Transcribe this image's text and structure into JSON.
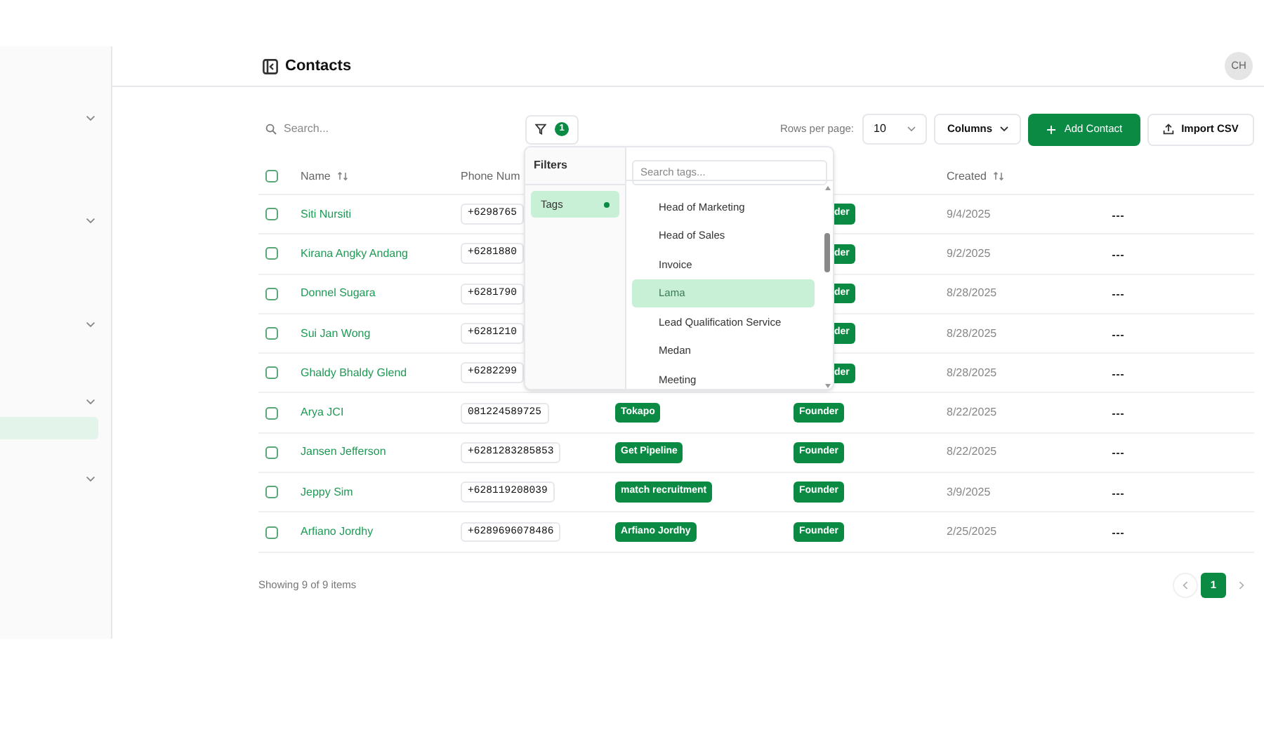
{
  "sidebar": {
    "rows": [
      {
        "kind": "group"
      },
      {
        "kind": "item",
        "selected": false
      },
      {
        "kind": "item",
        "selected": false
      },
      {
        "kind": "item",
        "selected": false
      },
      {
        "kind": "group"
      },
      {
        "kind": "item",
        "selected": false
      },
      {
        "kind": "item",
        "selected": false
      },
      {
        "kind": "item",
        "selected": false
      },
      {
        "kind": "group"
      },
      {
        "kind": "item",
        "selected": false
      },
      {
        "kind": "item",
        "selected": false
      },
      {
        "kind": "group"
      },
      {
        "kind": "item",
        "selected": true
      },
      {
        "kind": "item",
        "selected": false
      },
      {
        "kind": "group"
      }
    ]
  },
  "header": {
    "title": "Contacts",
    "avatar": "CH"
  },
  "toolbar": {
    "search_placeholder": "Search...",
    "filter_count": "1",
    "rows_per_page_label": "Rows per page:",
    "rows_per_page": "10",
    "columns_button": "Columns",
    "add_button": "Add Contact",
    "import_button": "Import CSV"
  },
  "table": {
    "all_selected": false,
    "columns": [
      "Name",
      "Phone Num",
      "Created"
    ],
    "rows": [
      {
        "selected": false,
        "name": "Siti Nursiti",
        "phone": "+6298765",
        "role": "der",
        "created": "9/4/2025"
      },
      {
        "selected": false,
        "name": "Kirana Angky Andang",
        "phone": "+6281880",
        "role": "der",
        "created": "9/2/2025"
      },
      {
        "selected": false,
        "name": "Donnel Sugara",
        "phone": "+6281790",
        "role": "der",
        "created": "8/28/2025"
      },
      {
        "selected": false,
        "name": "Sui Jan Wong",
        "phone": "+6281210",
        "role": "der",
        "created": "8/28/2025"
      },
      {
        "selected": false,
        "name": "Ghaldy Bhaldy Glend",
        "phone": "+6282299",
        "role": "der",
        "created": "8/28/2025"
      },
      {
        "selected": false,
        "name": "Arya JCI",
        "phone": "081224589725",
        "tag": "Tokapo",
        "role": "Founder",
        "created": "8/22/2025"
      },
      {
        "selected": false,
        "name": "Jansen Jefferson",
        "phone": "+6281283285853",
        "tag": "Get Pipeline",
        "role": "Founder",
        "created": "8/22/2025"
      },
      {
        "selected": false,
        "name": "Jeppy Sim",
        "phone": "+628119208039",
        "tag": "match recruitment",
        "role": "Founder",
        "created": "3/9/2025"
      },
      {
        "selected": false,
        "name": "Arfiano Jordhy",
        "phone": "+6289696078486",
        "tag": "Arfiano Jordhy",
        "role": "Founder",
        "created": "2/25/2025"
      }
    ]
  },
  "filter_popover": {
    "title": "Filters",
    "categories": [
      {
        "label": "Tags",
        "selected": true,
        "active": true
      }
    ],
    "search_placeholder": "Search tags...",
    "options": [
      {
        "label": "Head of Marketing",
        "selected": false
      },
      {
        "label": "Head of Sales",
        "selected": false
      },
      {
        "label": "Invoice",
        "selected": false
      },
      {
        "label": "Lama",
        "selected": true
      },
      {
        "label": "Lead Qualification Service",
        "selected": false
      },
      {
        "label": "Medan",
        "selected": false
      },
      {
        "label": "Meeting",
        "selected": false
      }
    ]
  },
  "footer": {
    "summary": "Showing 9 of 9 items",
    "pages": [
      {
        "label": "1",
        "selected": true
      }
    ]
  }
}
